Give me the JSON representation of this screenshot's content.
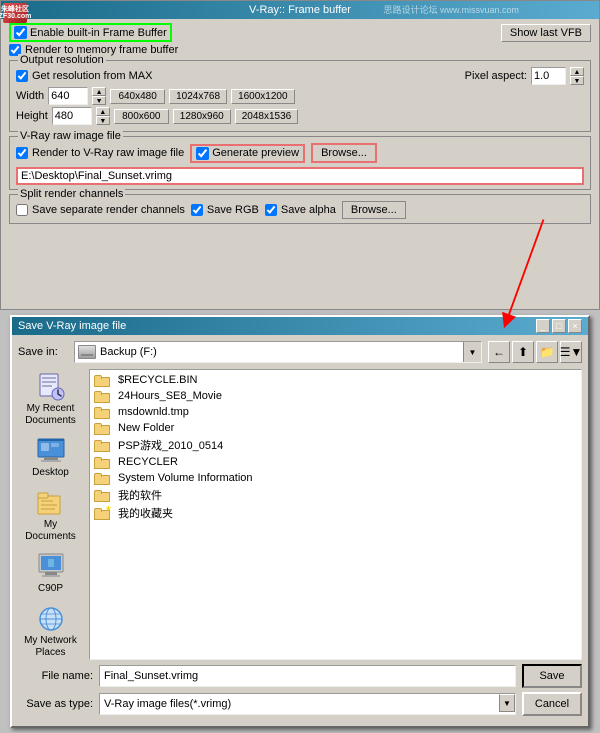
{
  "vray": {
    "title": "V-Ray:: Frame buffer",
    "watermark": "思路设计论坛 www.missvuan.com",
    "logo_text": "朱峰社区\nZF30.com",
    "show_vfb_btn": "Show last VFB",
    "enable_fb_label": "Enable built-in Frame Buffer",
    "render_memory_label": "Render to memory frame buffer",
    "output_resolution": {
      "label": "Output resolution",
      "get_res_label": "Get resolution from MAX",
      "pixel_aspect_label": "Pixel aspect:",
      "pixel_aspect_value": "1.0",
      "width_label": "Width",
      "height_label": "Height",
      "width_value": "640",
      "height_value": "480",
      "presets": [
        "640x480",
        "1024x768",
        "1600x1200",
        "800x600",
        "1280x960",
        "2048x1536"
      ]
    },
    "raw_image": {
      "label": "V-Ray raw image file",
      "render_raw_label": "Render to V-Ray raw image file",
      "gen_preview_label": "Generate preview",
      "browse_btn": "Browse...",
      "path_value": "E:\\Desktop\\Final_Sunset.vrimg"
    },
    "split_channels": {
      "label": "Split render channels",
      "save_separate_label": "Save separate render channels",
      "save_rgb_label": "Save RGB",
      "save_alpha_label": "Save alpha",
      "browse_btn": "Browse..."
    }
  },
  "save_dialog": {
    "title": "Save V-Ray image file",
    "close_btn": "×",
    "minimize_btn": "_",
    "maximize_btn": "□",
    "save_in_label": "Save in:",
    "save_in_value": "Backup (F:)",
    "nav_items": [
      {
        "id": "recent",
        "label": "My Recent\nDocuments",
        "icon": "📄"
      },
      {
        "id": "desktop",
        "label": "Desktop",
        "icon": "🖥"
      },
      {
        "id": "mydocs",
        "label": "My Documents",
        "icon": "📁"
      },
      {
        "id": "computer",
        "label": "C90P",
        "icon": "💻"
      },
      {
        "id": "network",
        "label": "My Network\nPlaces",
        "icon": "🌐"
      }
    ],
    "files": [
      {
        "name": "$RECYCLE.BIN",
        "type": "folder"
      },
      {
        "name": "24Hours_SE8_Movie",
        "type": "folder"
      },
      {
        "name": "msdownld.tmp",
        "type": "folder"
      },
      {
        "name": "New Folder",
        "type": "folder"
      },
      {
        "name": "PSP游戏_2010_0514",
        "type": "folder"
      },
      {
        "name": "RECYCLER",
        "type": "folder"
      },
      {
        "name": "System Volume Information",
        "type": "folder"
      },
      {
        "name": "我的软件",
        "type": "folder"
      },
      {
        "name": "我的收藏夹",
        "type": "folder-star"
      }
    ],
    "file_name_label": "File name:",
    "file_name_value": "Final_Sunset.vrimg",
    "save_as_type_label": "Save as type:",
    "save_as_type_value": "V-Ray image files(*.vrimg)",
    "save_btn": "Save",
    "cancel_btn": "Cancel"
  }
}
